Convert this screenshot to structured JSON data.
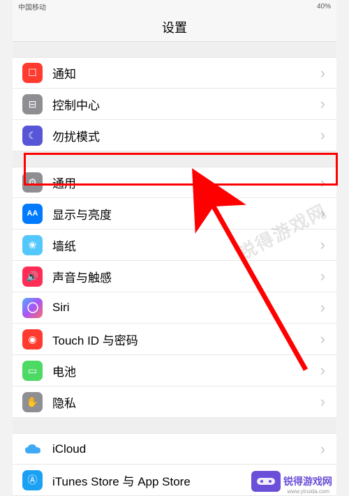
{
  "statusBar": {
    "carrier": "中国移动",
    "battery": "40%"
  },
  "header": {
    "title": "设置"
  },
  "groups": [
    {
      "rows": [
        {
          "id": "notifications",
          "label": "通知",
          "iconName": "notification-icon",
          "iconClass": "ic-red",
          "glyph": "☐"
        },
        {
          "id": "control-center",
          "label": "控制中心",
          "iconName": "control-center-icon",
          "iconClass": "ic-gray",
          "glyph": "⊟"
        },
        {
          "id": "dnd",
          "label": "勿扰模式",
          "iconName": "moon-icon",
          "iconClass": "ic-purple",
          "glyph": "☾"
        }
      ]
    },
    {
      "rows": [
        {
          "id": "general",
          "label": "通用",
          "iconName": "gear-icon",
          "iconClass": "ic-gear",
          "glyph": "⚙",
          "highlighted": true
        },
        {
          "id": "display",
          "label": "显示与亮度",
          "iconName": "text-size-icon",
          "iconClass": "ic-blue",
          "glyph": "AA"
        },
        {
          "id": "wallpaper",
          "label": "墙纸",
          "iconName": "wallpaper-icon",
          "iconClass": "ic-cyan",
          "glyph": "❀"
        },
        {
          "id": "sounds",
          "label": "声音与触感",
          "iconName": "speaker-icon",
          "iconClass": "ic-pink",
          "glyph": "🔊"
        },
        {
          "id": "siri",
          "label": "Siri",
          "iconName": "siri-icon",
          "iconClass": "ic-siri",
          "glyph": ""
        },
        {
          "id": "touchid",
          "label": "Touch ID 与密码",
          "iconName": "fingerprint-icon",
          "iconClass": "ic-touch",
          "glyph": "◉"
        },
        {
          "id": "battery",
          "label": "电池",
          "iconName": "battery-icon",
          "iconClass": "ic-green",
          "glyph": "▭"
        },
        {
          "id": "privacy",
          "label": "隐私",
          "iconName": "hand-icon",
          "iconClass": "ic-hand",
          "glyph": "✋"
        }
      ]
    },
    {
      "rows": [
        {
          "id": "icloud",
          "label": "iCloud",
          "iconName": "cloud-icon",
          "iconClass": "ic-cloud",
          "glyph": "☁"
        },
        {
          "id": "itunes",
          "label": "iTunes Store 与 App Store",
          "iconName": "appstore-icon",
          "iconClass": "ic-store",
          "glyph": "Ⓐ"
        }
      ]
    }
  ],
  "annotation": {
    "arrowColor": "#ff0000"
  },
  "watermark": {
    "text": "锐得游戏网",
    "logoText": "锐得游戏网",
    "url": "www.ytruida.com"
  }
}
